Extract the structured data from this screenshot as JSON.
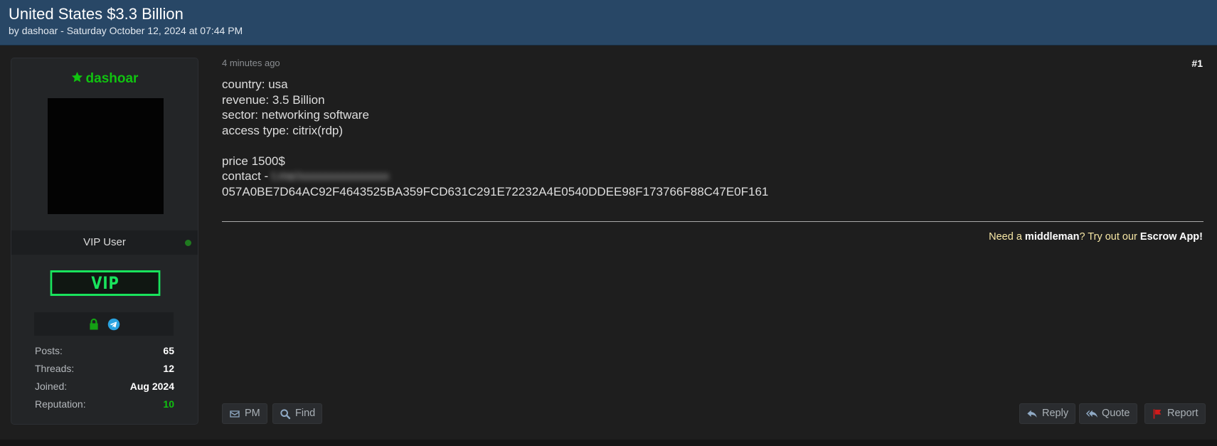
{
  "thread": {
    "title": "United States $3.3 Billion",
    "by_prefix": "by",
    "author": "dashoar",
    "date": "- Saturday October 12, 2024 at 07:44 PM"
  },
  "user": {
    "name": "dashoar",
    "rank": "VIP User",
    "badge": "VIP",
    "stats": [
      {
        "label": "Posts:",
        "value": "65"
      },
      {
        "label": "Threads:",
        "value": "12"
      },
      {
        "label": "Joined:",
        "value": "Aug 2024"
      },
      {
        "label": "Reputation:",
        "value": "10"
      }
    ],
    "icons": [
      "lock-icon",
      "telegram-icon"
    ]
  },
  "post": {
    "time": "4 minutes ago",
    "number": "#1",
    "lines": [
      "country: usa",
      "revenue: 3.5 Billion",
      "sector: networking software",
      "access type: citrix(rdp)",
      "",
      "price 1500$"
    ],
    "contact_label": "contact -",
    "contact_hidden": "t.me/xxxxxxxxxxxxxxx",
    "hash": "057A0BE7D64AC92F4643525BA359FCD631C291E72232A4E0540DDEE98F173766F88C47E0F161",
    "signature": {
      "pre": "Need a ",
      "bold1": "middleman",
      "mid": "? Try out our ",
      "bold2": "Escrow App!"
    }
  },
  "buttons": {
    "pm": "PM",
    "find": "Find",
    "reply": "Reply",
    "quote": "Quote",
    "report": "Report"
  },
  "colors": {
    "header_bg": "#284766",
    "username": "#10c310",
    "vip": "#19e35c",
    "signature": "#f7e7a5"
  }
}
